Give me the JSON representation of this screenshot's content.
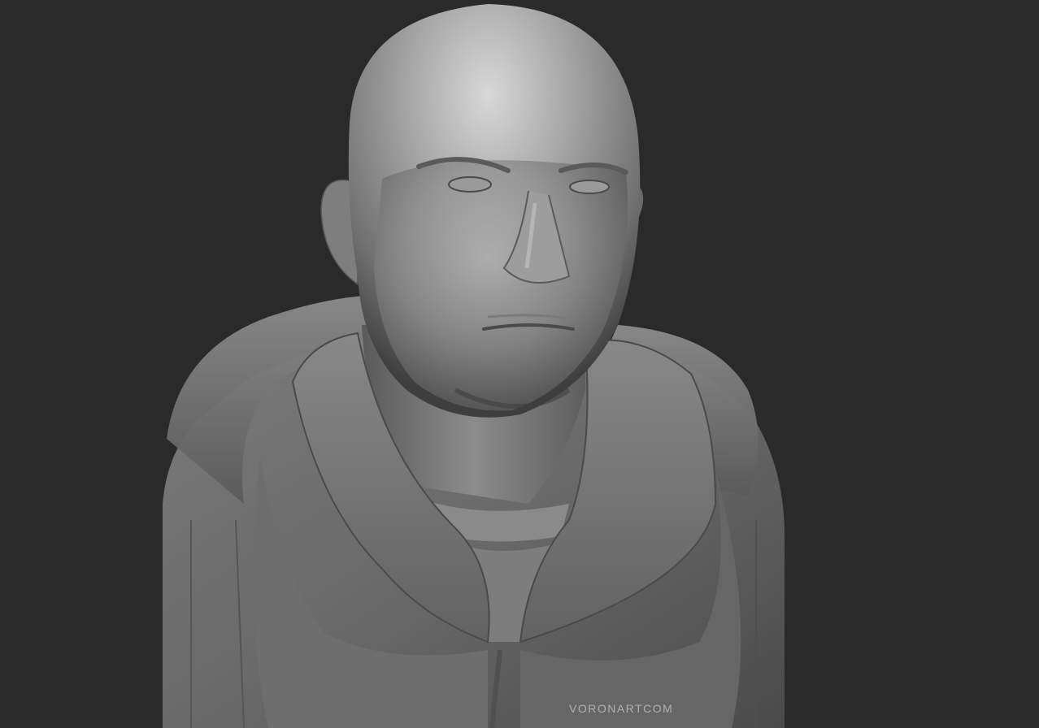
{
  "scene": {
    "subject": "sculpt-bust-icon",
    "background_color": "#2a2a2a",
    "material_color": "#8a8a8a"
  },
  "watermark": {
    "text": "VORONARTCOM"
  }
}
